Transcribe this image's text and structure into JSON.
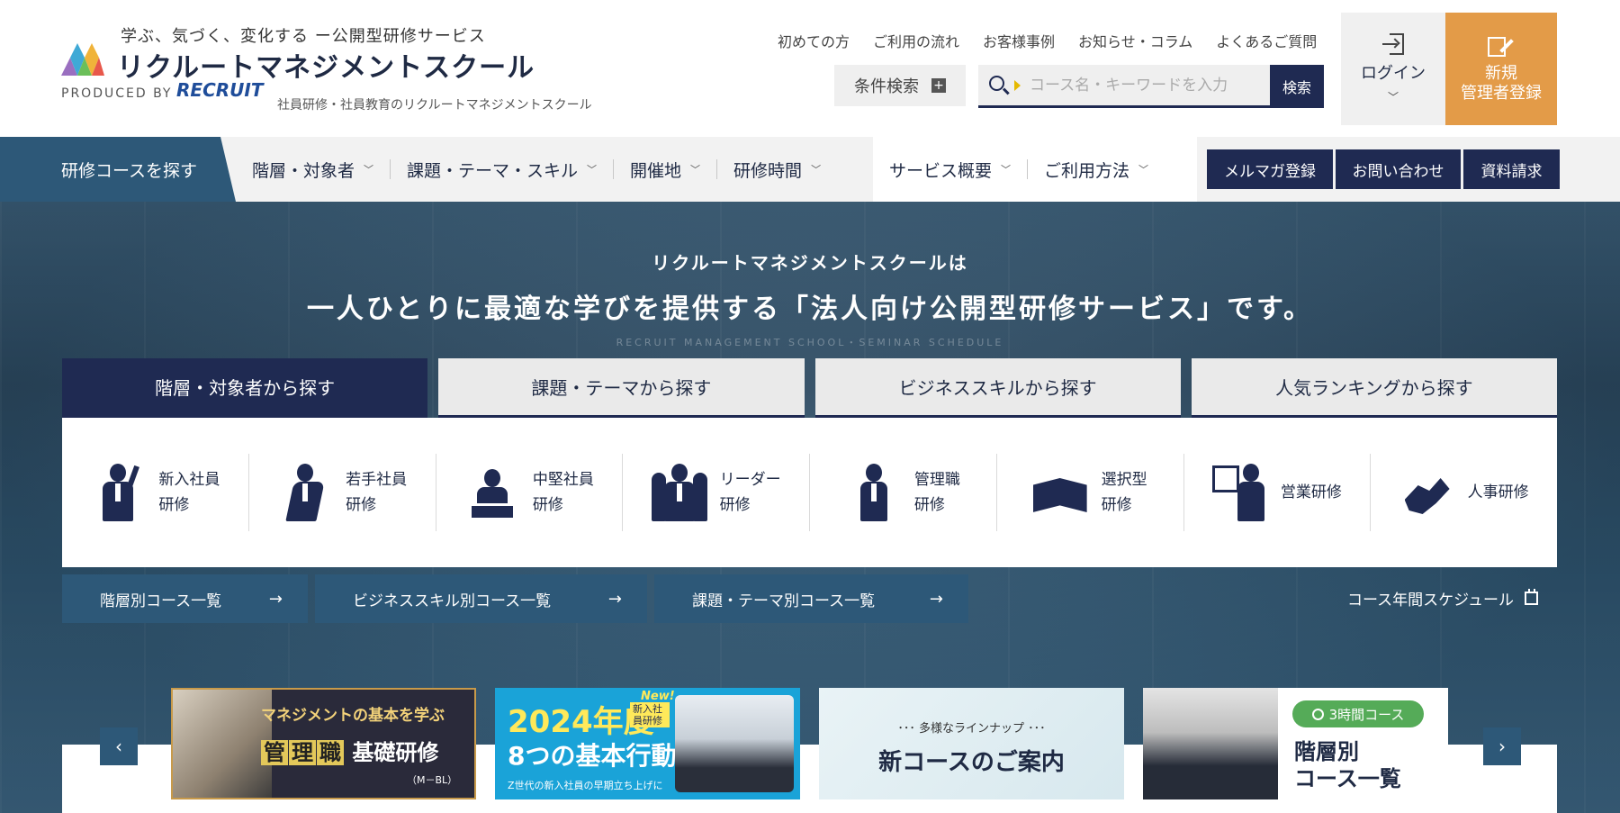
{
  "header": {
    "tagline": "学ぶ、気づく、変化する ー公開型研修サービス",
    "brand_name": "リクルートマネジメントスクール",
    "produced_by": "PRODUCED BY",
    "recruit_logo": "RECRUIT",
    "produced_desc": "社員研修・社員教育のリクルートマネジメントスクール",
    "util_links": [
      "初めての方",
      "ご利用の流れ",
      "お客様事例",
      "お知らせ・コラム",
      "よくあるご質問"
    ],
    "cond_search_label": "条件検索",
    "search_placeholder": "コース名・キーワードを入力",
    "search_button": "検索",
    "login_label": "ログイン",
    "register_label_1": "新規",
    "register_label_2": "管理者登録"
  },
  "nav": {
    "find_course": "研修コースを探す",
    "items": [
      "階層・対象者",
      "課題・テーマ・スキル",
      "開催地",
      "研修時間"
    ],
    "service_items": [
      "サービス概要",
      "ご利用方法"
    ],
    "buttons": [
      "メルマガ登録",
      "お問い合わせ",
      "資料請求"
    ]
  },
  "hero": {
    "lead": "リクルートマネジメントスクールは",
    "title": "一人ひとりに最適な学びを提供する「法人向け公開型研修サービス」です。",
    "subtitle": "RECRUIT MANAGEMENT SCHOOL・SEMINAR SCHEDULE"
  },
  "tabs": [
    "階層・対象者から探す",
    "課題・テーマから探す",
    "ビジネススキルから探す",
    "人気ランキングから探す"
  ],
  "categories": [
    {
      "label": "新入社員\n研修",
      "icon": "new-employee-icon"
    },
    {
      "label": "若手社員\n研修",
      "icon": "young-employee-icon"
    },
    {
      "label": "中堅社員\n研修",
      "icon": "mid-level-employee-icon"
    },
    {
      "label": "リーダー\n研修",
      "icon": "leader-icon"
    },
    {
      "label": "管理職\n研修",
      "icon": "manager-icon"
    },
    {
      "label": "選択型\n研修",
      "icon": "book-icon"
    },
    {
      "label": "営業研修",
      "icon": "sales-icon"
    },
    {
      "label": "人事研修",
      "icon": "handshake-icon"
    }
  ],
  "course_links": [
    "階層別コース一覧",
    "ビジネススキル別コース一覧",
    "課題・テーマ別コース一覧"
  ],
  "schedule_link": "コース年間スケジュール",
  "banners": {
    "b1": {
      "line1": "マネジメントの基本を学ぶ",
      "hl": [
        "管",
        "理",
        "職"
      ],
      "line2": "基礎研修",
      "line3": "（M－BL）"
    },
    "b2": {
      "year": "2024年度",
      "tag": "新入社員研修",
      "new": "New!",
      "main": "8つの基本行動",
      "sub": "Z世代の新入社員の早期立ち上げに"
    },
    "b3": {
      "sub": "･･･ 多様なラインナップ ･･･",
      "main": "新コースのご案内"
    },
    "b4": {
      "pill": "3時間コース",
      "main": "階層別\nコース一覧"
    }
  },
  "colors": {
    "navy": "#1f2a52",
    "steel": "#2d5878",
    "orange": "#e39b48",
    "green": "#55ab58"
  }
}
